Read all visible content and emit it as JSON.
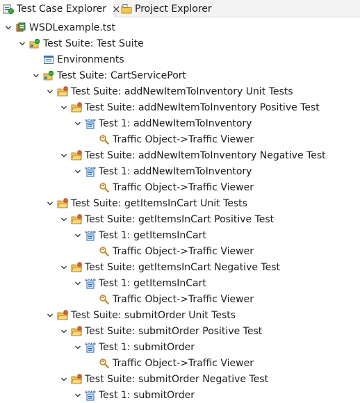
{
  "tabs": [
    {
      "label": "Test Case Explorer",
      "icon": "test-case-explorer-icon",
      "active": true,
      "close": "×"
    },
    {
      "label": "Project Explorer",
      "icon": "project-explorer-icon",
      "active": false
    }
  ],
  "tree": [
    {
      "label": "WSDLexample.tst",
      "icon": "tst-file-icon",
      "expanded": true,
      "level": 1
    },
    {
      "label": "Test Suite: Test Suite",
      "icon": "test-suite-icon",
      "expanded": true,
      "level": 2
    },
    {
      "label": "Environments",
      "icon": "environments-icon",
      "expanded": null,
      "level": 3
    },
    {
      "label": "Test Suite: CartServicePort",
      "icon": "test-suite-icon",
      "expanded": true,
      "level": 3
    },
    {
      "label": "Test Suite: addNewItemToInventory Unit Tests",
      "icon": "folder-suite-icon",
      "expanded": true,
      "level": 4
    },
    {
      "label": "Test Suite: addNewItemToInventory Positive Test",
      "icon": "folder-suite-icon",
      "expanded": true,
      "level": 5
    },
    {
      "label": "Test 1: addNewItemToInventory",
      "icon": "soap-client-icon",
      "expanded": true,
      "level": 6
    },
    {
      "label": "Traffic Object->Traffic Viewer",
      "icon": "traffic-viewer-icon",
      "expanded": null,
      "level": 7
    },
    {
      "label": "Test Suite: addNewItemToInventory Negative Test",
      "icon": "folder-suite-icon",
      "expanded": true,
      "level": 5
    },
    {
      "label": "Test 1: addNewItemToInventory",
      "icon": "soap-client-icon",
      "expanded": true,
      "level": 6
    },
    {
      "label": "Traffic Object->Traffic Viewer",
      "icon": "traffic-viewer-icon",
      "expanded": null,
      "level": 7
    },
    {
      "label": "Test Suite: getItemsInCart Unit Tests",
      "icon": "folder-suite-icon",
      "expanded": true,
      "level": 4
    },
    {
      "label": "Test Suite: getItemsInCart Positive Test",
      "icon": "folder-suite-icon",
      "expanded": true,
      "level": 5
    },
    {
      "label": "Test 1: getItemsInCart",
      "icon": "soap-client-icon",
      "expanded": true,
      "level": 6
    },
    {
      "label": "Traffic Object->Traffic Viewer",
      "icon": "traffic-viewer-icon",
      "expanded": null,
      "level": 7
    },
    {
      "label": "Test Suite: getItemsInCart Negative Test",
      "icon": "folder-suite-icon",
      "expanded": true,
      "level": 5
    },
    {
      "label": "Test 1: getItemsInCart",
      "icon": "soap-client-icon",
      "expanded": true,
      "level": 6
    },
    {
      "label": "Traffic Object->Traffic Viewer",
      "icon": "traffic-viewer-icon",
      "expanded": null,
      "level": 7
    },
    {
      "label": "Test Suite: submitOrder Unit Tests",
      "icon": "folder-suite-icon",
      "expanded": true,
      "level": 4
    },
    {
      "label": "Test Suite: submitOrder Positive Test",
      "icon": "folder-suite-icon",
      "expanded": true,
      "level": 5
    },
    {
      "label": "Test 1: submitOrder",
      "icon": "soap-client-icon",
      "expanded": true,
      "level": 6
    },
    {
      "label": "Traffic Object->Traffic Viewer",
      "icon": "traffic-viewer-icon",
      "expanded": null,
      "level": 7
    },
    {
      "label": "Test Suite: submitOrder Negative Test",
      "icon": "folder-suite-icon",
      "expanded": true,
      "level": 5
    },
    {
      "label": "Test 1: submitOrder",
      "icon": "soap-client-icon",
      "expanded": true,
      "level": 6
    }
  ]
}
